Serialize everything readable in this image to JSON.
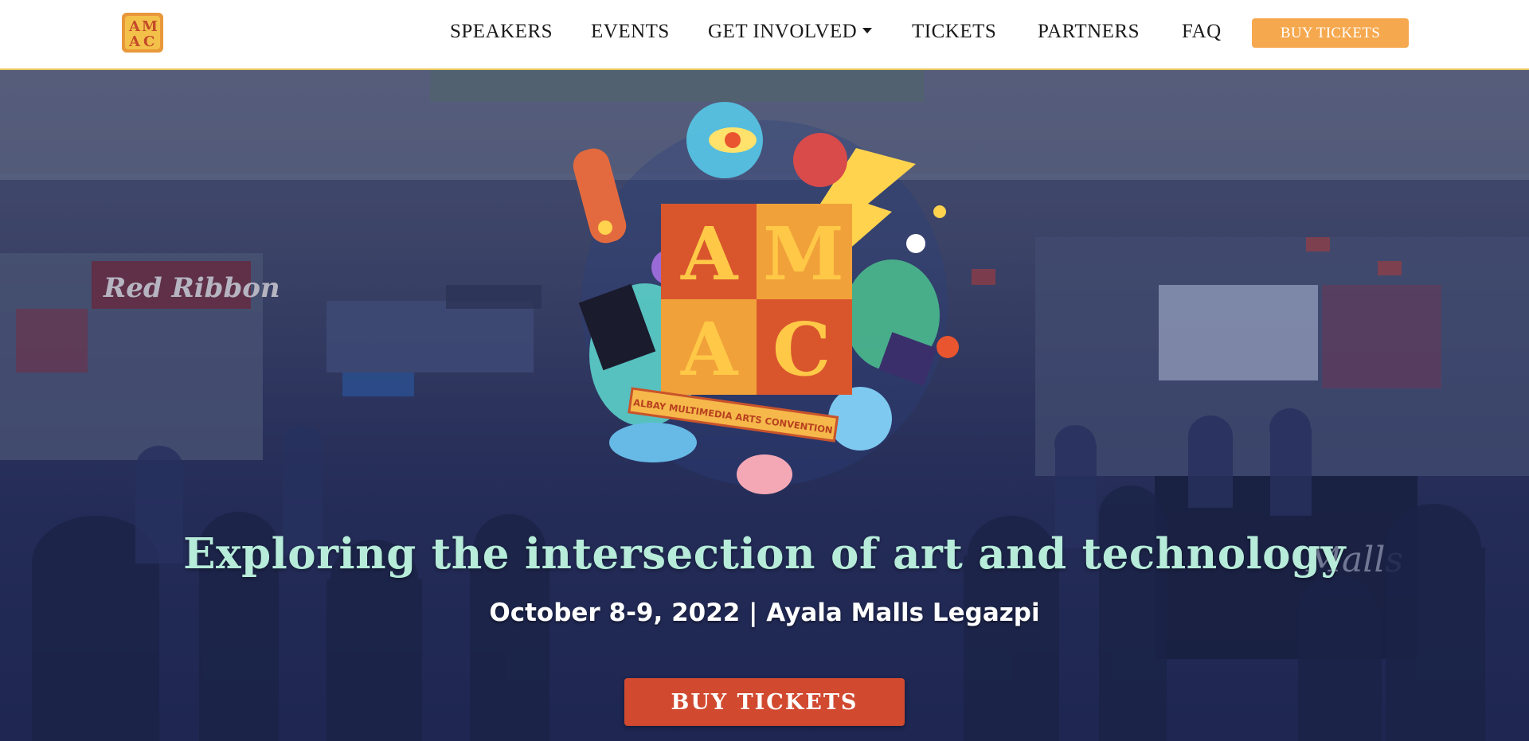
{
  "nav": {
    "logo_alt": "AMAC",
    "items": [
      {
        "label": "SPEAKERS"
      },
      {
        "label": "EVENTS"
      },
      {
        "label": "GET INVOLVED",
        "has_dropdown": true
      },
      {
        "label": "TICKETS"
      },
      {
        "label": "PARTNERS"
      },
      {
        "label": "FAQ"
      }
    ],
    "cta_label": "BUY TICKETS"
  },
  "hero": {
    "emblem_letters": "AMAC",
    "emblem_banner": "ALBAY MULTIMEDIA ARTS CONVENTION",
    "headline": "Exploring the intersection of art and technology",
    "subline": "October 8-9, 2022 | Ayala Malls Legazpi",
    "cta_label": "BUY TICKETS"
  },
  "background_signs": {
    "sign1": "Red Ribbon",
    "sign2": "Malls"
  },
  "colors": {
    "nav_cta": "#f6a84e",
    "hero_cta": "#d14a30",
    "headline": "#b6ecd9",
    "overlay": "#1e2652"
  }
}
